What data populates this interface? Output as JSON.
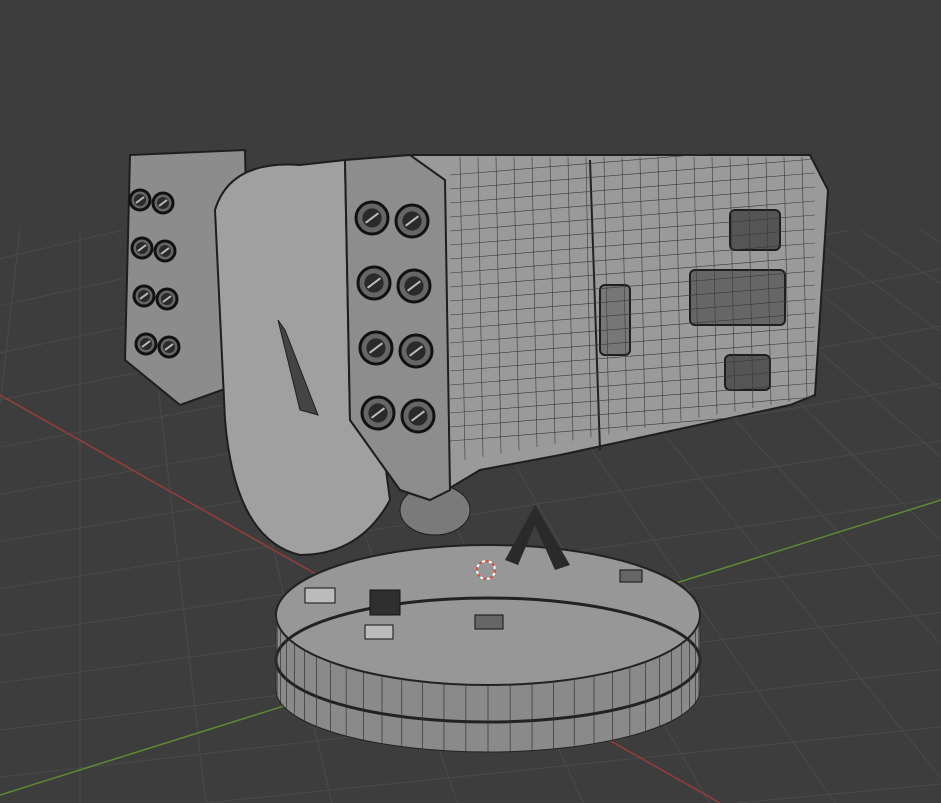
{
  "viewport": {
    "background_color": "#3d3d3d",
    "grid_color": "#4a4a4a",
    "x_axis_color": "#9a3b3b",
    "y_axis_color": "#5f8a34",
    "model_color": "#8f8f8f",
    "wire_color": "#2a2a2a",
    "cursor_color": "#d9503a"
  }
}
